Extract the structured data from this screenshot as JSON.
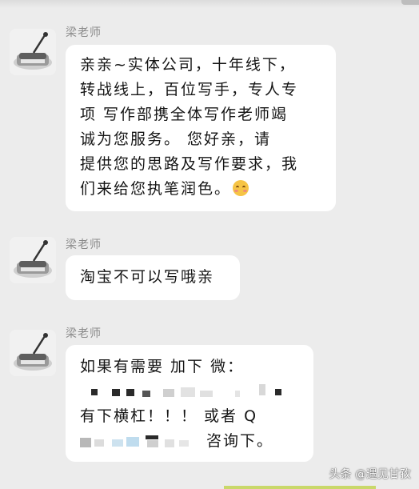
{
  "conversation": {
    "messages": [
      {
        "sender": "梁老师",
        "lines": [
          "亲亲~实体公司，十年线下，",
          "转战线上，百位写手，专人专",
          "项  写作部携全体写作老师竭",
          "诚为您服务。     您好亲，请",
          "提供您的思路及写作要求，我",
          "们来给您执笔润色。"
        ],
        "emoji": "blushing-face"
      },
      {
        "sender": "梁老师",
        "lines": [
          "淘宝不可以写哦亲"
        ]
      },
      {
        "sender": "梁老师",
        "lines": [
          "如果有需要 加下 微：",
          "有下横杠！！！ 或者 Q",
          "咨询下。"
        ]
      }
    ]
  },
  "watermark": "头条 @遇见甘孜",
  "colors": {
    "background": "#ececec",
    "bubble": "#ffffff",
    "text": "#151515",
    "sender": "#8a8a8a"
  }
}
